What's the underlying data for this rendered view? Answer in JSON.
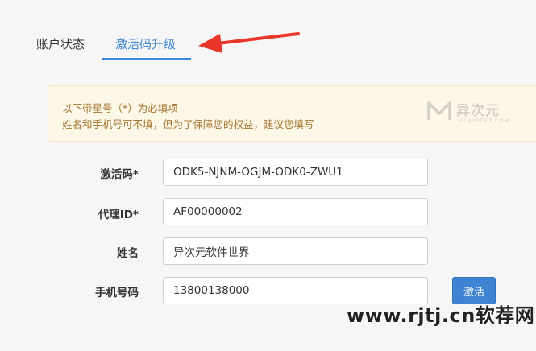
{
  "tabs": [
    {
      "label": "账户状态"
    },
    {
      "label": "激活码升级"
    }
  ],
  "notice": {
    "line1": "以下带星号（*）为必填项",
    "line2": "姓名和手机号可不填，但为了保障您的权益，建议您填写",
    "watermark_cn": "异次元",
    "watermark_en": "IPLAYSOFT.COM"
  },
  "form": {
    "activation_code": {
      "label": "激活码*",
      "value": "ODK5-NJNM-OGJM-ODK0-ZWU1"
    },
    "agent_id": {
      "label": "代理ID*",
      "value": "AF00000002"
    },
    "name": {
      "label": "姓名",
      "value": "异次元软件世界"
    },
    "phone": {
      "label": "手机号码",
      "value": "13800138000"
    },
    "submit_label": "激活"
  },
  "site_watermark": "www.rjtj.cn软荐网",
  "colors": {
    "accent": "#3d86d6",
    "arrow": "#e8362a",
    "notice_bg": "#fcf7e6",
    "notice_text": "#a5752f"
  }
}
